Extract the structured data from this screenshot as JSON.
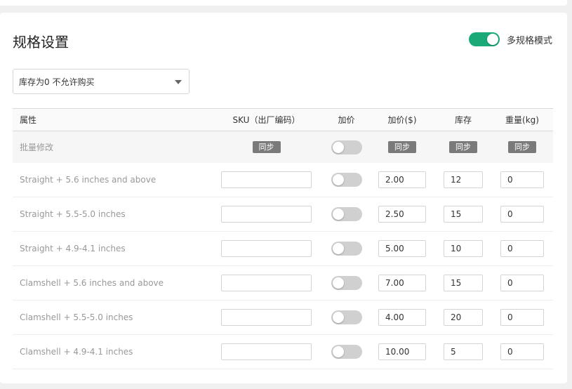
{
  "page_title": "规格设置",
  "multi_spec": {
    "label": "多规格模式",
    "enabled": true
  },
  "stock_select": {
    "value": "库存为0 不允许购买"
  },
  "table": {
    "headers": {
      "attr": "属性",
      "sku": "SKU（出厂编码）",
      "add_price": "加价",
      "price": "加价($)",
      "stock": "库存",
      "weight": "重量(kg)"
    },
    "batch": {
      "label": "批量修改",
      "sync_label": "同步"
    },
    "rows": [
      {
        "name": "Straight + 5.6 inches and above",
        "sku": "",
        "add_price_on": false,
        "price": "2.00",
        "stock": "12",
        "weight": "0"
      },
      {
        "name": "Straight + 5.5-5.0 inches",
        "sku": "",
        "add_price_on": false,
        "price": "2.50",
        "stock": "15",
        "weight": "0"
      },
      {
        "name": "Straight + 4.9-4.1 inches",
        "sku": "",
        "add_price_on": false,
        "price": "5.00",
        "stock": "10",
        "weight": "0"
      },
      {
        "name": "Clamshell + 5.6 inches and above",
        "sku": "",
        "add_price_on": false,
        "price": "7.00",
        "stock": "15",
        "weight": "0"
      },
      {
        "name": "Clamshell + 5.5-5.0 inches",
        "sku": "",
        "add_price_on": false,
        "price": "4.00",
        "stock": "20",
        "weight": "0"
      },
      {
        "name": "Clamshell + 4.9-4.1 inches",
        "sku": "",
        "add_price_on": false,
        "price": "10.00",
        "stock": "5",
        "weight": "0"
      }
    ]
  },
  "colors": {
    "switch_on": "#1aaa77",
    "switch_off": "#d0d0d0",
    "sync_button": "#7a7a7a"
  }
}
